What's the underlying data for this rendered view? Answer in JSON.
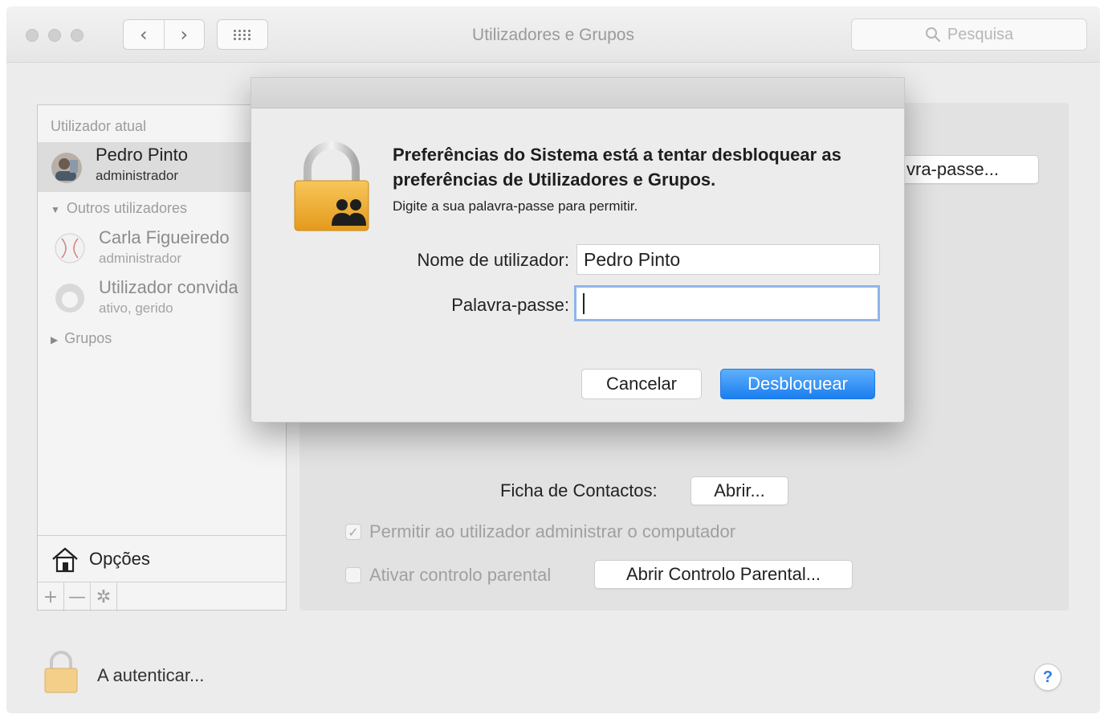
{
  "window": {
    "title": "Utilizadores e Grupos",
    "search_placeholder": "Pesquisa",
    "nav_back": "‹",
    "nav_forward": "›"
  },
  "sidebar": {
    "current_user_header": "Utilizador atual",
    "current_user": {
      "name": "Pedro  Pinto",
      "role": "administrador"
    },
    "other_users_header": "Outros utilizadores",
    "other_users": [
      {
        "name": "Carla Figueiredo",
        "role": "administrador"
      },
      {
        "name": "Utilizador convida",
        "role": "ativo, gerido"
      }
    ],
    "groups_label": "Grupos",
    "options_label": "Opções",
    "tools": {
      "add": "+",
      "remove": "—",
      "gear": "✲"
    }
  },
  "main": {
    "password_button_partial": "vra-passe...",
    "contacts_label": "Ficha de Contactos:",
    "contacts_open_button": "Abrir...",
    "allow_admin_checkbox": {
      "label": "Permitir ao utilizador administrar o computador",
      "checked": true
    },
    "parental_checkbox": {
      "label": "Ativar controlo parental",
      "checked": false
    },
    "parental_button": "Abrir Controlo Parental..."
  },
  "footer": {
    "auth_status": "A autenticar...",
    "help_label": "?"
  },
  "dialog": {
    "title": "Preferências do Sistema está a tentar desbloquear as preferências de Utilizadores e Grupos.",
    "subtitle": "Digite a sua palavra-passe para permitir.",
    "username_label": "Nome de utilizador:",
    "username_value": "Pedro  Pinto",
    "password_label": "Palavra-passe:",
    "password_value": "",
    "cancel_button": "Cancelar",
    "unlock_button": "Desbloquear"
  },
  "colors": {
    "accent": "#1a7ef0",
    "focus_ring": "#8db6e9",
    "lock_gold": "#f2b230",
    "help_blue": "#2f7de1"
  }
}
